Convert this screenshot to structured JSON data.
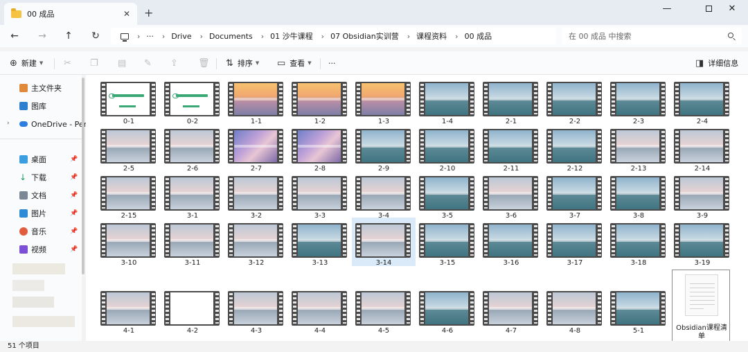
{
  "window": {
    "tab_title": "00 成品",
    "close_tab_glyph": "✕",
    "new_tab_glyph": "+",
    "minimize_glyph": "—",
    "close_glyph": "✕"
  },
  "nav": {
    "back_glyph": "←",
    "forward_glyph": "→",
    "up_glyph": "↑",
    "refresh_glyph": "↻",
    "more_glyph": "···",
    "breadcrumbs": [
      "Drive",
      "Documents",
      "01 沙牛课程",
      "07 Obsidian实训营",
      "课程资料",
      "00 成品"
    ],
    "search_placeholder": "在 00 成品 中搜索"
  },
  "toolbar": {
    "new_label": "新建",
    "sort_label": "排序",
    "view_label": "查看",
    "more_glyph": "···",
    "details_label": "详细信息"
  },
  "sidebar": {
    "home": "主文件夹",
    "gallery": "图库",
    "onedrive": "OneDrive - Per",
    "desktop": "桌面",
    "downloads": "下载",
    "documents": "文档",
    "pictures": "图片",
    "music": "音乐",
    "videos": "视频"
  },
  "files": [
    {
      "name": "0-1",
      "thumb": "doc"
    },
    {
      "name": "0-2",
      "thumb": "doc"
    },
    {
      "name": "1-1",
      "thumb": "sunset"
    },
    {
      "name": "1-2",
      "thumb": "sunset"
    },
    {
      "name": "1-3",
      "thumb": "sunset"
    },
    {
      "name": "1-4",
      "thumb": "lake"
    },
    {
      "name": "2-1",
      "thumb": "lake"
    },
    {
      "name": "2-2",
      "thumb": "lake"
    },
    {
      "name": "2-3",
      "thumb": "lake"
    },
    {
      "name": "2-4",
      "thumb": "lake"
    },
    {
      "name": "2-5",
      "thumb": "pink"
    },
    {
      "name": "2-6",
      "thumb": "pink"
    },
    {
      "name": "2-7",
      "thumb": "neon"
    },
    {
      "name": "2-8",
      "thumb": "neon"
    },
    {
      "name": "2-9",
      "thumb": "lake"
    },
    {
      "name": "2-10",
      "thumb": "lake"
    },
    {
      "name": "2-11",
      "thumb": "lake"
    },
    {
      "name": "2-12",
      "thumb": "lake"
    },
    {
      "name": "2-13",
      "thumb": "pink"
    },
    {
      "name": "2-14",
      "thumb": "pink"
    },
    {
      "name": "2-15",
      "thumb": "pink"
    },
    {
      "name": "3-1",
      "thumb": "pink"
    },
    {
      "name": "3-2",
      "thumb": "pink"
    },
    {
      "name": "3-3",
      "thumb": "pink"
    },
    {
      "name": "3-4",
      "thumb": "pink"
    },
    {
      "name": "3-5",
      "thumb": "lake"
    },
    {
      "name": "3-6",
      "thumb": "pink"
    },
    {
      "name": "3-7",
      "thumb": "lake"
    },
    {
      "name": "3-8",
      "thumb": "lake"
    },
    {
      "name": "3-9",
      "thumb": "pink"
    },
    {
      "name": "3-10",
      "thumb": "pink"
    },
    {
      "name": "3-11",
      "thumb": "pink"
    },
    {
      "name": "3-12",
      "thumb": "pink"
    },
    {
      "name": "3-13",
      "thumb": "lake"
    },
    {
      "name": "3-14",
      "thumb": "pink"
    },
    {
      "name": "3-15",
      "thumb": "lake"
    },
    {
      "name": "3-16",
      "thumb": "lake"
    },
    {
      "name": "3-17",
      "thumb": "lake"
    },
    {
      "name": "3-18",
      "thumb": "lake"
    },
    {
      "name": "3-19",
      "thumb": "lake"
    },
    {
      "name": "4-1",
      "thumb": "pink"
    },
    {
      "name": "4-2",
      "thumb": "white"
    },
    {
      "name": "4-3",
      "thumb": "pink"
    },
    {
      "name": "4-4",
      "thumb": "pink"
    },
    {
      "name": "4-5",
      "thumb": "pink"
    },
    {
      "name": "4-6",
      "thumb": "lake"
    },
    {
      "name": "4-7",
      "thumb": "pink"
    },
    {
      "name": "4-8",
      "thumb": "pink"
    },
    {
      "name": "5-1",
      "thumb": "lake"
    }
  ],
  "selected_file": "3-14",
  "document_file": {
    "line1": "Obsidian课程清",
    "line2": "单"
  },
  "status": {
    "count": "51 个项目"
  }
}
